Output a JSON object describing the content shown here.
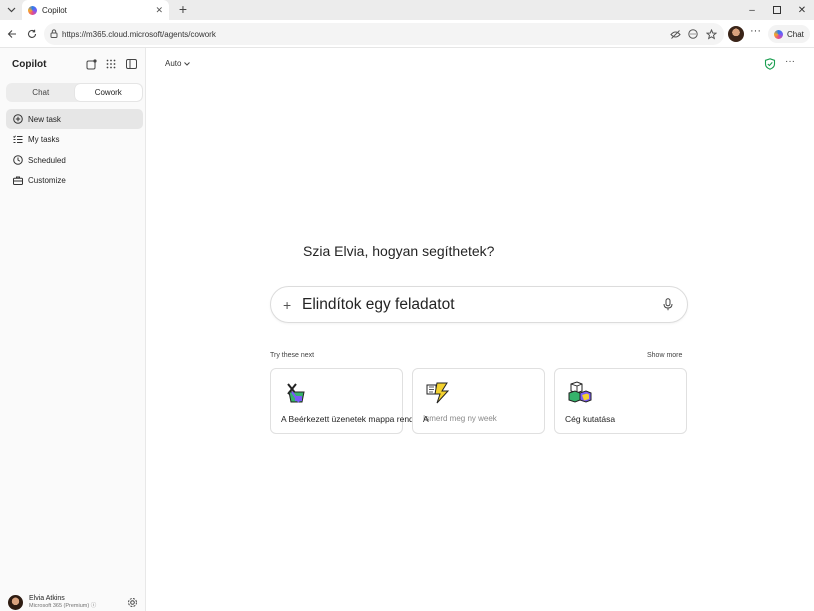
{
  "browser": {
    "tab_title": "Copilot",
    "url": "https://m365.cloud.microsoft/agents/cowork",
    "chat_button": "Chat"
  },
  "sidebar": {
    "brand": "Copilot",
    "segments": [
      "Chat",
      "Cowork"
    ],
    "active_segment": "Cowork",
    "nav": [
      {
        "label": "New task",
        "icon": "plus-circle-icon"
      },
      {
        "label": "My tasks",
        "icon": "task-list-icon"
      },
      {
        "label": "Scheduled",
        "icon": "clock-icon"
      },
      {
        "label": "Customize",
        "icon": "briefcase-icon"
      }
    ],
    "user": {
      "name": "Elvia Atkins",
      "plan": "Microsoft 365 (Premium)"
    }
  },
  "main": {
    "model": "Auto",
    "greeting": "Szia Elvia, hogyan segíthetek?",
    "composer_text": "Elindítok egy feladatot",
    "try_label": "Try these next",
    "show_more": "Show more",
    "cards": [
      {
        "label": "A Beérkezett üzenetek mappa rendszerezése",
        "icon": "inbox-sort-icon"
      },
      {
        "label": "A",
        "sub": "Ismerd meg ny week",
        "icon": "lightning-icon"
      },
      {
        "label": "Cég kutatása",
        "icon": "research-cubes-icon"
      }
    ]
  },
  "colors": {
    "accent": "#2b7de9",
    "shield": "#1a9e50",
    "card_yellow": "#f3d12f",
    "card_purple": "#7a5af8",
    "card_green": "#35b36b"
  }
}
